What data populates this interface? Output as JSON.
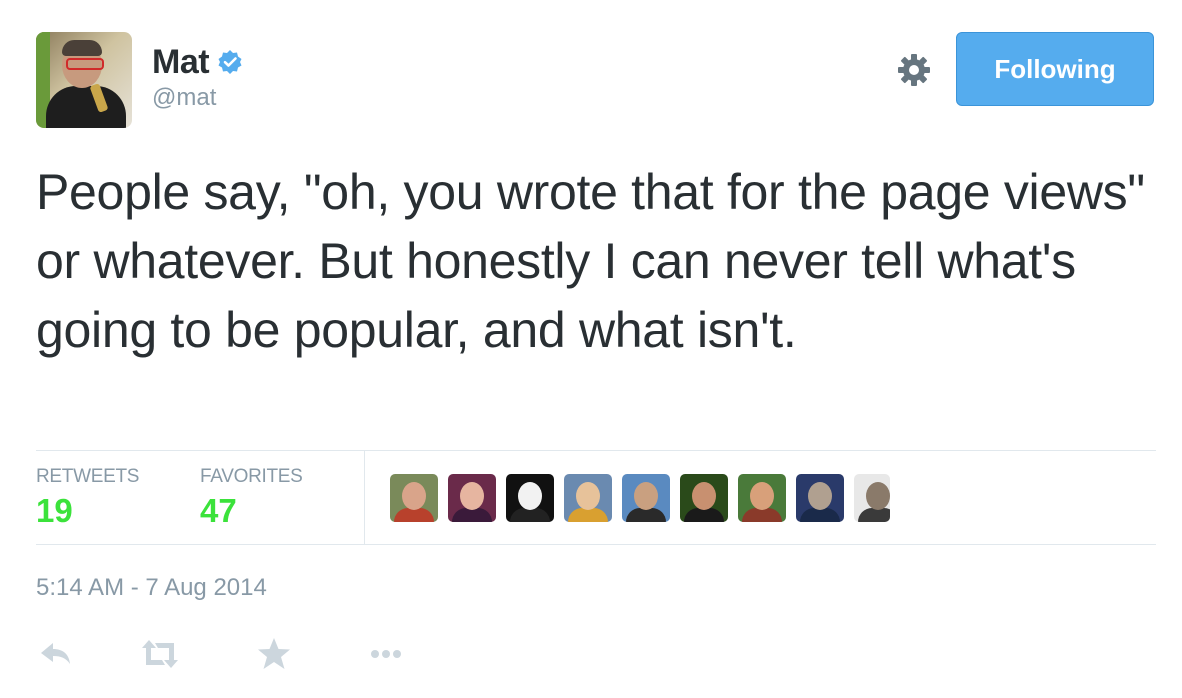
{
  "user": {
    "name": "Mat",
    "handle": "@mat",
    "avatar_icon": "profile-photo",
    "verified_icon": "verified-badge-icon"
  },
  "header": {
    "follow_button_label": "Following",
    "gear_icon": "gear-icon"
  },
  "tweet": {
    "text": "People say, \"oh, you wrote that for the page views\" or whatever. But honestly I can never tell what's going to be popular, and what isn't.",
    "timestamp": "5:14 AM - 7 Aug 2014"
  },
  "stats": {
    "retweets_label": "RETWEETS",
    "retweets_count": "19",
    "favorites_label": "FAVORITES",
    "favorites_count": "47"
  },
  "favoriters": [
    {
      "skin": "#d9a48a",
      "bg": "#7a8a5a",
      "shirt": "#b8412c"
    },
    {
      "skin": "#e6b5a0",
      "bg": "#6a2a4a",
      "shirt": "#3a1a3a"
    },
    {
      "skin": "#f2f2f2",
      "bg": "#111111",
      "shirt": "#222222"
    },
    {
      "skin": "#e7c29a",
      "bg": "#6a8ab0",
      "shirt": "#d9a030"
    },
    {
      "skin": "#c9a080",
      "bg": "#5a8ac0",
      "shirt": "#2a2a2a"
    },
    {
      "skin": "#c89070",
      "bg": "#2a4a1a",
      "shirt": "#1a1a1a"
    },
    {
      "skin": "#d8a07a",
      "bg": "#4a7a3a",
      "shirt": "#8a3a2a"
    },
    {
      "skin": "#b0a090",
      "bg": "#2a3a6a",
      "shirt": "#1a2a4a"
    },
    {
      "skin": "#8a7a6a",
      "bg": "#e8e8e8",
      "shirt": "#3a3a3a"
    }
  ],
  "actions": {
    "reply_icon": "reply-icon",
    "retweet_icon": "retweet-icon",
    "favorite_icon": "star-icon",
    "more_icon": "more-icon"
  },
  "colors": {
    "accent": "#55acee",
    "count_green": "#3be23b",
    "muted": "#8899a6"
  }
}
